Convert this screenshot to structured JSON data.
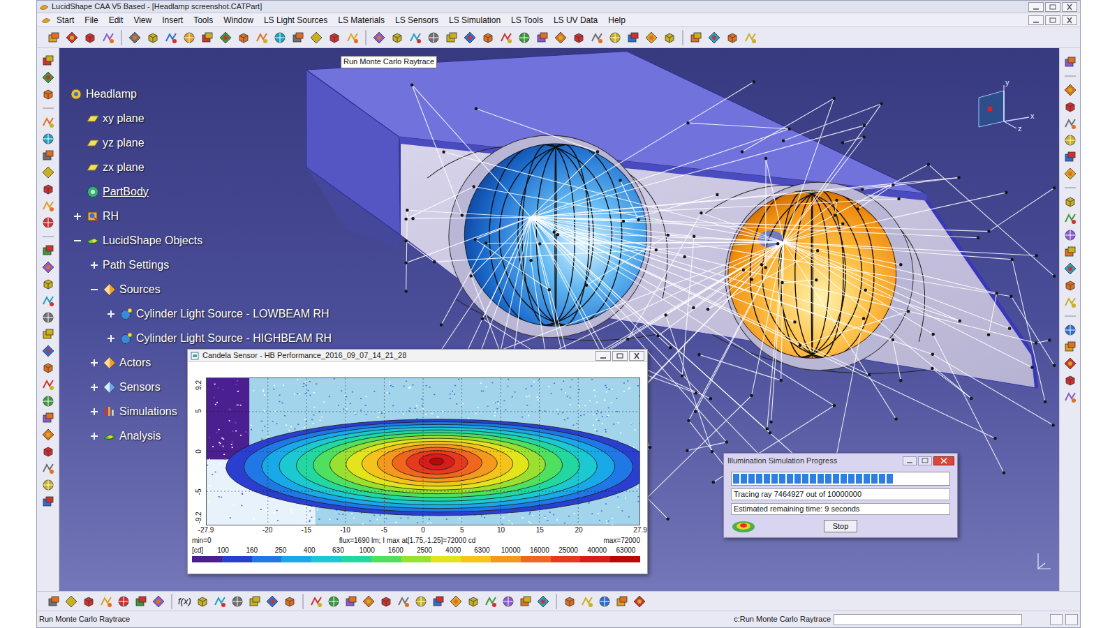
{
  "window": {
    "title": "LucidShape CAA V5 Based - [Headlamp screenshot.CATPart]"
  },
  "menu": [
    "Start",
    "File",
    "Edit",
    "View",
    "Insert",
    "Tools",
    "Window",
    "LS Light Sources",
    "LS Materials",
    "LS Sensors",
    "LS Simulation",
    "LS Tools",
    "LS UV Data",
    "Help"
  ],
  "tooltip": "Run Monte Carlo Raytrace",
  "tree": [
    {
      "label": "Headlamp",
      "depth": 0,
      "kind": "product",
      "expandable": false,
      "expanded": false,
      "current": false
    },
    {
      "label": "xy plane",
      "depth": 1,
      "kind": "plane",
      "expandable": false,
      "expanded": false,
      "current": false
    },
    {
      "label": "yz plane",
      "depth": 1,
      "kind": "plane",
      "expandable": false,
      "expanded": false,
      "current": false
    },
    {
      "label": "zx plane",
      "depth": 1,
      "kind": "plane",
      "expandable": false,
      "expanded": false,
      "current": false
    },
    {
      "label": "PartBody",
      "depth": 1,
      "kind": "body",
      "expandable": false,
      "expanded": false,
      "current": true
    },
    {
      "label": "RH",
      "depth": 1,
      "kind": "part",
      "expandable": true,
      "expanded": false,
      "current": false
    },
    {
      "label": "LucidShape Objects",
      "depth": 1,
      "kind": "objects",
      "expandable": true,
      "expanded": true,
      "current": false
    },
    {
      "label": "Path Settings",
      "depth": 2,
      "kind": "settings",
      "expandable": true,
      "expanded": false,
      "current": false
    },
    {
      "label": "Sources",
      "depth": 2,
      "kind": "folder",
      "expandable": true,
      "expanded": true,
      "current": false
    },
    {
      "label": "Cylinder Light Source - LOWBEAM RH",
      "depth": 3,
      "kind": "source",
      "expandable": true,
      "expanded": false,
      "current": false
    },
    {
      "label": "Cylinder Light Source - HIGHBEAM RH",
      "depth": 3,
      "kind": "source",
      "expandable": true,
      "expanded": false,
      "current": false
    },
    {
      "label": "Actors",
      "depth": 2,
      "kind": "folder",
      "expandable": true,
      "expanded": false,
      "current": false
    },
    {
      "label": "Sensors",
      "depth": 2,
      "kind": "sensors",
      "expandable": true,
      "expanded": false,
      "current": false
    },
    {
      "label": "Simulations",
      "depth": 2,
      "kind": "simulations",
      "expandable": true,
      "expanded": false,
      "current": false
    },
    {
      "label": "Analysis",
      "depth": 2,
      "kind": "analysis",
      "expandable": true,
      "expanded": false,
      "current": false
    }
  ],
  "compass": {
    "labels": [
      "x",
      "y",
      "z"
    ]
  },
  "candela_window": {
    "title": "Candela Sensor - HB Performance_2016_09_07_14_21_28",
    "y_ticks": [
      "9.2",
      "5",
      "0",
      "-5",
      "-9.2"
    ],
    "x_ticks": [
      "-27.9",
      "-20",
      "-15",
      "-10",
      "-5",
      "0",
      "5",
      "10",
      "15",
      "20",
      "27.9"
    ],
    "peak": {
      "h": 1.75,
      "v": -1.25
    },
    "info": {
      "min": "min=0",
      "flux": "flux=1690 lm; I max at[1.75,-1.25]=72000 cd",
      "max": "max=72000"
    },
    "unit": "[cd]",
    "scale": [
      {
        "label": "100",
        "color": "#4b1f8f"
      },
      {
        "label": "160",
        "color": "#2a3fd0"
      },
      {
        "label": "250",
        "color": "#1f78e6"
      },
      {
        "label": "400",
        "color": "#19a8e8"
      },
      {
        "label": "630",
        "color": "#1cc9d0"
      },
      {
        "label": "1000",
        "color": "#22d8a0"
      },
      {
        "label": "1600",
        "color": "#4fe060"
      },
      {
        "label": "2500",
        "color": "#9ae030"
      },
      {
        "label": "4000",
        "color": "#e2e41c"
      },
      {
        "label": "6300",
        "color": "#f4c41c"
      },
      {
        "label": "10000",
        "color": "#f5981e"
      },
      {
        "label": "16000",
        "color": "#f0661e"
      },
      {
        "label": "25000",
        "color": "#e63a1e"
      },
      {
        "label": "40000",
        "color": "#d81c1c"
      },
      {
        "label": "63000",
        "color": "#b80808"
      }
    ]
  },
  "progress_dialog": {
    "title": "Illumination Simulation Progress",
    "level": 0.7464927,
    "status": "Tracing ray 7464927 out of 10000000",
    "remaining": "Estimated remaining time: 9 seconds",
    "button": "Stop"
  },
  "bottom_toolbar": {
    "formula": "f(x)"
  },
  "status_bar": {
    "left": "Run Monte Carlo Raytrace",
    "right": "c:Run Monte Carlo Raytrace"
  }
}
